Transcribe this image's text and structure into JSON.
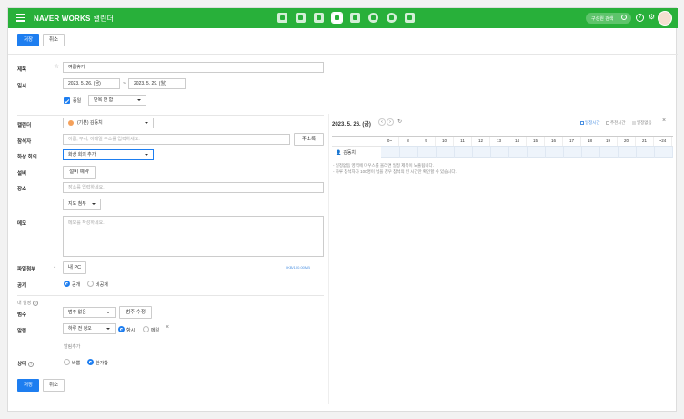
{
  "header": {
    "brand": "NAVER WORKS",
    "app_name": "캘린더",
    "search_label": "구성원 검색",
    "help": "?",
    "settings": "⚙"
  },
  "toolbar": {
    "save": "저장",
    "cancel": "취소"
  },
  "form": {
    "title_label": "제목",
    "title_value": "여름휴가",
    "datetime_label": "일시",
    "start_date": "2023. 5. 26. (금)",
    "date_sep": "~",
    "end_date": "2023. 5. 29. (월)",
    "allday_label": "종일",
    "repeat_value": "반복 안 함",
    "calendar_label": "캘린더",
    "calendar_value": "(기본) 김동치",
    "attendees_label": "참석자",
    "attendees_placeholder": "이름, 부서, 이메일 주소를 입력하세요.",
    "address_book": "주소록",
    "video_label": "화상 회의",
    "video_value": "화상 회의 추가",
    "facility_label": "설비",
    "facility_button": "설비 예약",
    "location_label": "장소",
    "location_placeholder": "장소를 입력하세요.",
    "map_attach": "지도 첨부",
    "memo_label": "메모",
    "memo_placeholder": "메모를 작성하세요.",
    "file_label": "파일첨부",
    "my_pc": "내 PC",
    "file_quota": "0KB/100.00MB",
    "public_label": "공개",
    "public_option": "공개",
    "private_option": "비공개",
    "my_settings": "내 설정",
    "category_label": "범주",
    "category_value": "범주 없음",
    "category_edit": "범주 수정",
    "alarm_label": "알림",
    "alarm_value": "하루 전 정오",
    "alarm_always": "항시",
    "alarm_mail": "메일",
    "alarm_add": "알림추가",
    "status_label": "상태",
    "status_busy": "바쁨",
    "status_free": "한가함"
  },
  "availability": {
    "date": "2023. 5. 26. (금)",
    "legend_busy": "일정시간",
    "legend_recommended": "추천시간",
    "legend_private": "일정없음",
    "hours": [
      "0~",
      "8",
      "9",
      "10",
      "11",
      "12",
      "13",
      "14",
      "15",
      "16",
      "17",
      "18",
      "19",
      "20",
      "21",
      "~24"
    ],
    "person": "김동치",
    "notes": [
      "- 일정없음 영역에 마우스를 올리면 일정 제목이 노출됩니다.",
      "- 하루 참석자가 100명이 넘을 경우 참석의 빈 시간만 확인할 수 있습니다."
    ]
  },
  "colors": {
    "green": "#28b03a",
    "blue": "#1e7ef0",
    "orange": "#f5a15b"
  }
}
